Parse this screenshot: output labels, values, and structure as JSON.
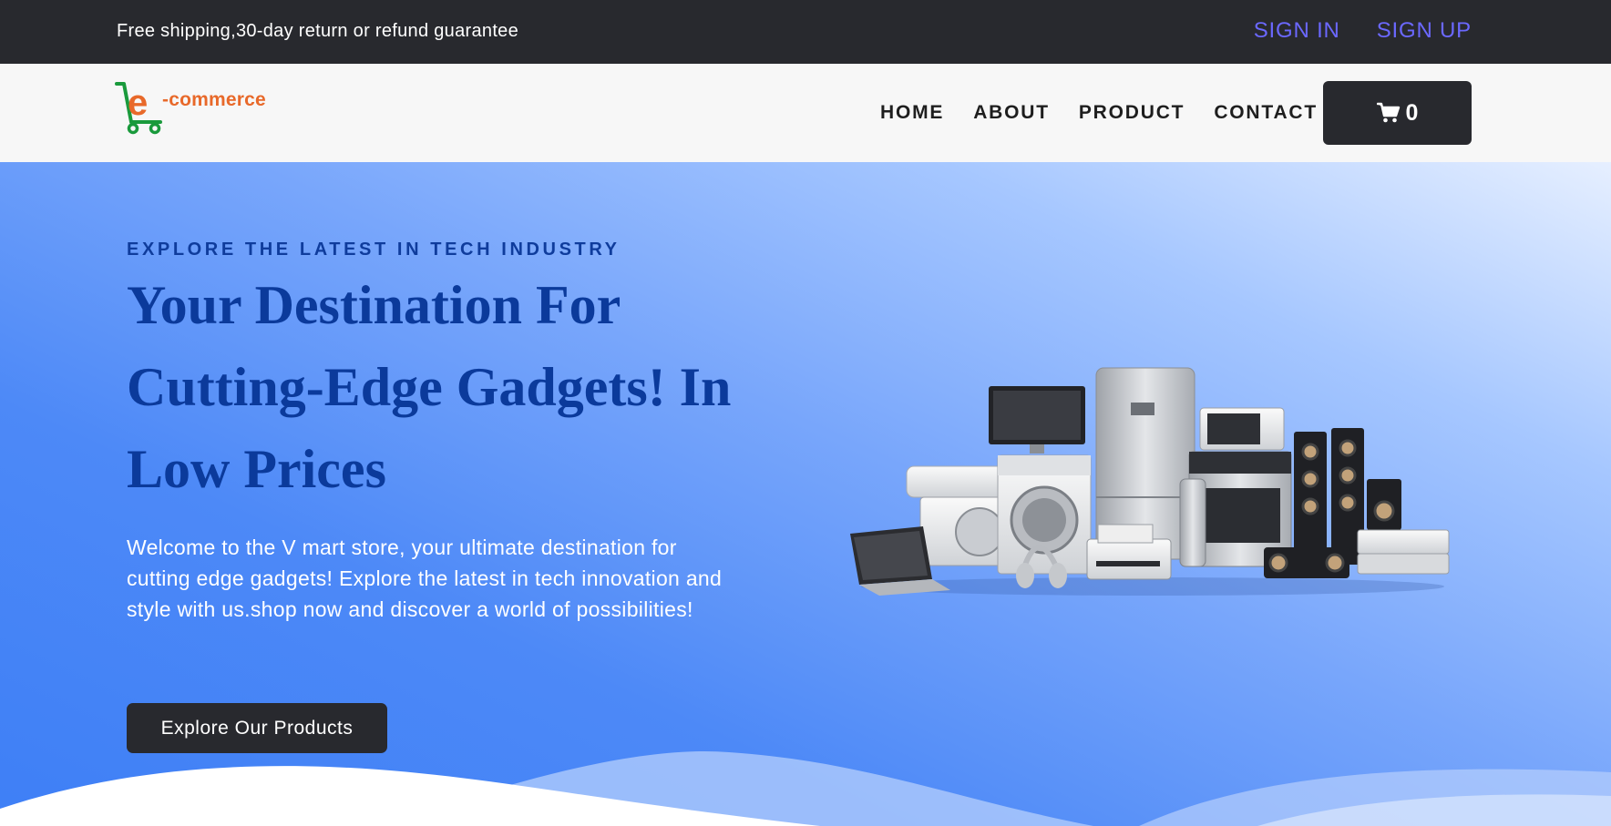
{
  "topbar": {
    "promo": "Free shipping,30-day return or refund guarantee",
    "sign_in": "SIGN IN",
    "sign_up": "SIGN UP"
  },
  "navbar": {
    "logo_text": "-commerce",
    "logo_letter": "e",
    "links": [
      "HOME",
      "ABOUT",
      "PRODUCT",
      "CONTACT"
    ],
    "cart_count": "0",
    "cart_icon": "shopping-cart-icon"
  },
  "hero": {
    "eyebrow": "EXPLORE THE LATEST IN TECH INDUSTRY",
    "headline": "Your Destination For Cutting-Edge Gadgets! In Low Prices",
    "description": "Welcome to the V mart store, your ultimate destination for cutting edge gadgets! Explore the latest in tech innovation and style with us.shop now and discover a world of possibilities!",
    "cta_label": "Explore Our Products",
    "image_subject": "home-appliances-electronics-image"
  },
  "colors": {
    "topbar_bg": "#28292e",
    "auth_link": "#6b68ff",
    "headline": "#0b3a9b",
    "logo_orange": "#e8692a",
    "logo_green": "#1a9a3c",
    "hero_blue": "#3e7ff6"
  }
}
